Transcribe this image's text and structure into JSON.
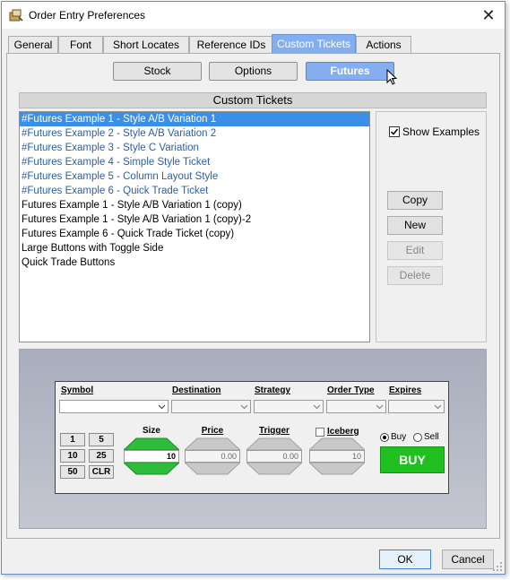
{
  "window": {
    "title": "Order Entry Preferences",
    "close_glyph": "✕"
  },
  "tabs": [
    {
      "label": "General",
      "active": false
    },
    {
      "label": "Font",
      "active": false
    },
    {
      "label": "Short Locates",
      "active": false
    },
    {
      "label": "Reference IDs",
      "active": false
    },
    {
      "label": "Custom Tickets",
      "active": true
    },
    {
      "label": "Actions",
      "active": false
    }
  ],
  "asset_buttons": {
    "stock": "Stock",
    "options": "Options",
    "futures": "Futures",
    "selected": "futures"
  },
  "section_header": "Custom Tickets",
  "ticket_list": [
    {
      "label": "#Futures Example 1 - Style A/B Variation 1",
      "example": true,
      "selected": true
    },
    {
      "label": "#Futures Example 2 - Style A/B Variation 2",
      "example": true,
      "selected": false
    },
    {
      "label": "#Futures Example 3 - Style C Variation",
      "example": true,
      "selected": false
    },
    {
      "label": "#Futures Example 4 - Simple Style Ticket",
      "example": true,
      "selected": false
    },
    {
      "label": "#Futures Example 5 - Column Layout Style",
      "example": true,
      "selected": false
    },
    {
      "label": "#Futures Example 6 - Quick Trade Ticket",
      "example": true,
      "selected": false
    },
    {
      "label": "Futures Example 1 - Style A/B Variation 1 (copy)",
      "example": false,
      "selected": false
    },
    {
      "label": "Futures Example 1 - Style A/B Variation 1 (copy)-2",
      "example": false,
      "selected": false
    },
    {
      "label": "Futures Example 6 - Quick Trade Ticket (copy)",
      "example": false,
      "selected": false
    },
    {
      "label": "Large Buttons with Toggle Side",
      "example": false,
      "selected": false
    },
    {
      "label": "Quick Trade Buttons",
      "example": false,
      "selected": false
    }
  ],
  "side_panel": {
    "show_examples_label": "Show Examples",
    "show_examples_checked": true,
    "copy": "Copy",
    "new": "New",
    "edit": "Edit",
    "delete": "Delete"
  },
  "preview_ticket": {
    "symbol_label": "Symbol",
    "destination_label": "Destination",
    "strategy_label": "Strategy",
    "order_type_label": "Order Type",
    "expires_label": "Expires",
    "quantity_buttons": [
      "1",
      "5",
      "10",
      "25",
      "50",
      "CLR"
    ],
    "size_label": "Size",
    "size_value": "10",
    "price_label": "Price",
    "price_value": "0.00",
    "trigger_label": "Trigger",
    "trigger_value": "0.00",
    "iceberg_label": "Iceberg",
    "iceberg_value": "10",
    "buy_radio": "Buy",
    "sell_radio": "Sell",
    "side_selected": "buy",
    "buy_button": "BUY"
  },
  "footer": {
    "ok": "OK",
    "cancel": "Cancel"
  },
  "colors": {
    "accent": "#84aef0",
    "selection": "#3b8fe6",
    "example_text": "#2b5fa8",
    "buy_green": "#20c020"
  }
}
